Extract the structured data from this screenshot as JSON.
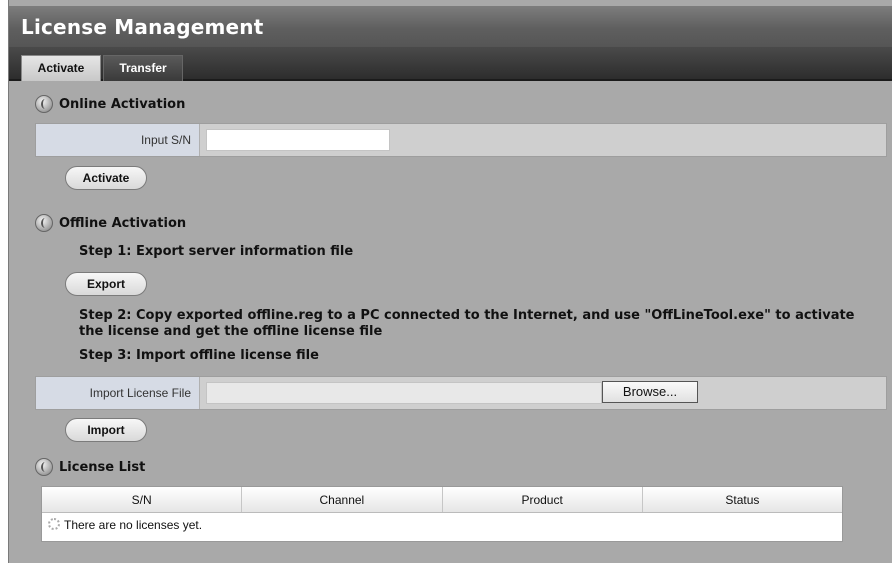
{
  "window": {
    "title": "License Management"
  },
  "tabs": [
    {
      "label": "Activate",
      "active": true
    },
    {
      "label": "Transfer",
      "active": false
    }
  ],
  "online": {
    "heading": "Online Activation",
    "sn_label": "Input S/N",
    "sn_value": "",
    "activate_button": "Activate"
  },
  "offline": {
    "heading": "Offline Activation",
    "step1": "Step 1: Export server information file",
    "export_button": "Export",
    "step2_line1": "Step 2: Copy exported offline.reg to a PC connected to the Internet, and use \"OffLineTool.exe\" to activate",
    "step2_line2": "the license and get the offline license file",
    "step3": "Step 3: Import offline license file",
    "import_label": "Import License File",
    "import_value": "",
    "browse_button": "Browse...",
    "import_button": "Import"
  },
  "license_list": {
    "heading": "License List",
    "columns": [
      "S/N",
      "Channel",
      "Product",
      "Status"
    ],
    "empty_message": "There are no licenses yet."
  },
  "icons": {
    "section": "section-globe-icon",
    "loading": "loading-icon"
  },
  "colors": {
    "background": "#a9a9a9",
    "title_bar": "#5f5f5f",
    "tab_bar": "#2d2d2d",
    "label_cell": "#d6dbe5"
  }
}
